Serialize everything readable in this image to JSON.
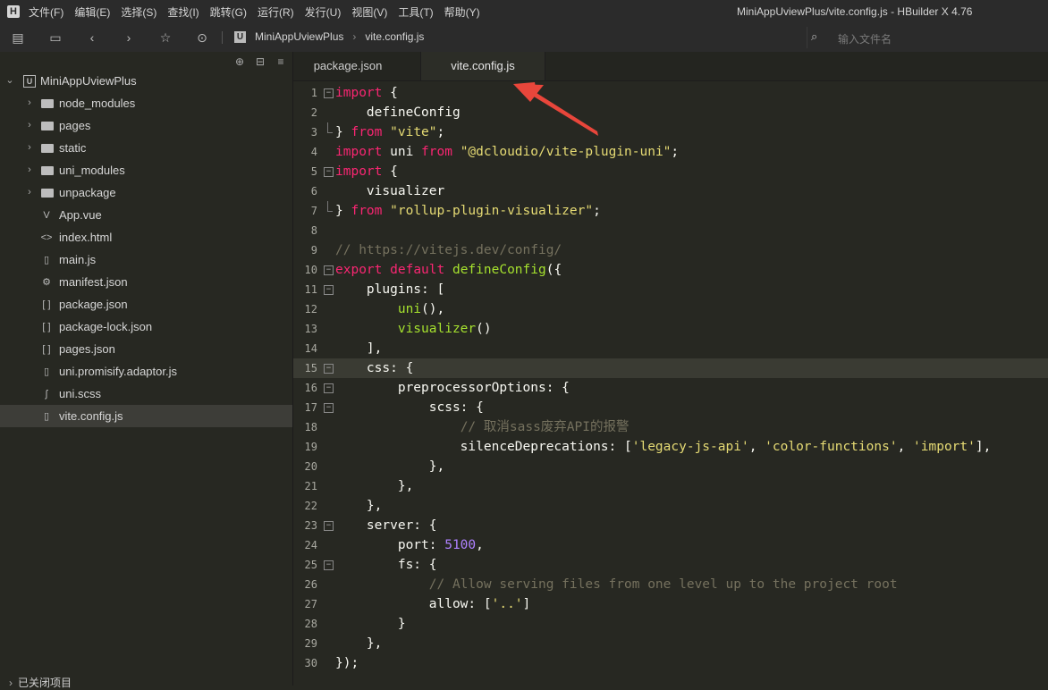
{
  "menubar": {
    "items": [
      "文件(F)",
      "编辑(E)",
      "选择(S)",
      "查找(I)",
      "跳转(G)",
      "运行(R)",
      "发行(U)",
      "视图(V)",
      "工具(T)",
      "帮助(Y)"
    ],
    "window_title": "MiniAppUviewPlus/vite.config.js - HBuilder X 4.76"
  },
  "toolbar": {
    "breadcrumb": [
      "MiniAppUviewPlus",
      "vite.config.js"
    ],
    "search_placeholder": "输入文件名"
  },
  "sidebar": {
    "project": "MiniAppUviewPlus",
    "items": [
      {
        "label": "node_modules",
        "type": "folder"
      },
      {
        "label": "pages",
        "type": "folder"
      },
      {
        "label": "static",
        "type": "folder"
      },
      {
        "label": "uni_modules",
        "type": "folder"
      },
      {
        "label": "unpackage",
        "type": "folder"
      },
      {
        "label": "App.vue",
        "type": "vue"
      },
      {
        "label": "index.html",
        "type": "html"
      },
      {
        "label": "main.js",
        "type": "js"
      },
      {
        "label": "manifest.json",
        "type": "manifest"
      },
      {
        "label": "package.json",
        "type": "json"
      },
      {
        "label": "package-lock.json",
        "type": "json"
      },
      {
        "label": "pages.json",
        "type": "json"
      },
      {
        "label": "uni.promisify.adaptor.js",
        "type": "js"
      },
      {
        "label": "uni.scss",
        "type": "scss"
      },
      {
        "label": "vite.config.js",
        "type": "js",
        "selected": true
      }
    ],
    "closed_projects": "已关闭项目"
  },
  "tabs": [
    {
      "label": "package.json",
      "active": false
    },
    {
      "label": "vite.config.js",
      "active": true
    }
  ],
  "editor": {
    "current_line": 15,
    "lines": [
      [
        [
          "kw",
          "import"
        ],
        [
          "pl",
          " {"
        ]
      ],
      [
        [
          "pl",
          "    defineConfig"
        ]
      ],
      [
        [
          "pl",
          "} "
        ],
        [
          "kw",
          "from"
        ],
        [
          "pl",
          " "
        ],
        [
          "str",
          "\"vite\""
        ],
        [
          "pl",
          ";"
        ]
      ],
      [
        [
          "kw",
          "import"
        ],
        [
          "pl",
          " uni "
        ],
        [
          "kw",
          "from"
        ],
        [
          "pl",
          " "
        ],
        [
          "str",
          "\"@dcloudio/vite-plugin-uni\""
        ],
        [
          "pl",
          ";"
        ]
      ],
      [
        [
          "kw",
          "import"
        ],
        [
          "pl",
          " {"
        ]
      ],
      [
        [
          "pl",
          "    visualizer"
        ]
      ],
      [
        [
          "pl",
          "} "
        ],
        [
          "kw",
          "from"
        ],
        [
          "pl",
          " "
        ],
        [
          "str",
          "\"rollup-plugin-visualizer\""
        ],
        [
          "pl",
          ";"
        ]
      ],
      [],
      [
        [
          "cm",
          "// https://vitejs.dev/config/"
        ]
      ],
      [
        [
          "kw",
          "export"
        ],
        [
          "pl",
          " "
        ],
        [
          "kw",
          "default"
        ],
        [
          "pl",
          " "
        ],
        [
          "fn",
          "defineConfig"
        ],
        [
          "pl",
          "({"
        ]
      ],
      [
        [
          "pl",
          "    plugins: ["
        ]
      ],
      [
        [
          "pl",
          "        "
        ],
        [
          "fn",
          "uni"
        ],
        [
          "pl",
          "(),"
        ]
      ],
      [
        [
          "pl",
          "        "
        ],
        [
          "fn",
          "visualizer"
        ],
        [
          "pl",
          "()"
        ]
      ],
      [
        [
          "pl",
          "    ],"
        ]
      ],
      [
        [
          "pl",
          "    css: {"
        ]
      ],
      [
        [
          "pl",
          "        preprocessorOptions: {"
        ]
      ],
      [
        [
          "pl",
          "            scss: {"
        ]
      ],
      [
        [
          "pl",
          "                "
        ],
        [
          "cm",
          "// 取消sass废弃API的报警"
        ]
      ],
      [
        [
          "pl",
          "                silenceDeprecations: ["
        ],
        [
          "str",
          "'legacy-js-api'"
        ],
        [
          "pl",
          ", "
        ],
        [
          "str",
          "'color-functions'"
        ],
        [
          "pl",
          ", "
        ],
        [
          "str",
          "'import'"
        ],
        [
          "pl",
          "],"
        ]
      ],
      [
        [
          "pl",
          "            },"
        ]
      ],
      [
        [
          "pl",
          "        },"
        ]
      ],
      [
        [
          "pl",
          "    },"
        ]
      ],
      [
        [
          "pl",
          "    server: {"
        ]
      ],
      [
        [
          "pl",
          "        port: "
        ],
        [
          "num",
          "5100"
        ],
        [
          "pl",
          ","
        ]
      ],
      [
        [
          "pl",
          "        fs: {"
        ]
      ],
      [
        [
          "pl",
          "            "
        ],
        [
          "cm",
          "// Allow serving files from one level up to the project root"
        ]
      ],
      [
        [
          "pl",
          "            allow: ["
        ],
        [
          "str",
          "'..'"
        ],
        [
          "pl",
          "]"
        ]
      ],
      [
        [
          "pl",
          "        }"
        ]
      ],
      [
        [
          "pl",
          "    },"
        ]
      ],
      [
        [
          "pl",
          "});"
        ]
      ]
    ],
    "fold_open": [
      1,
      5,
      10,
      11,
      15,
      16,
      17,
      23,
      25
    ],
    "fold_close": [
      3,
      7
    ]
  },
  "colors": {
    "keyword": "#f92672",
    "string": "#e6db74",
    "function": "#a6e22e",
    "number": "#ae81ff",
    "comment": "#75715e",
    "arrow": "#e8463b"
  }
}
